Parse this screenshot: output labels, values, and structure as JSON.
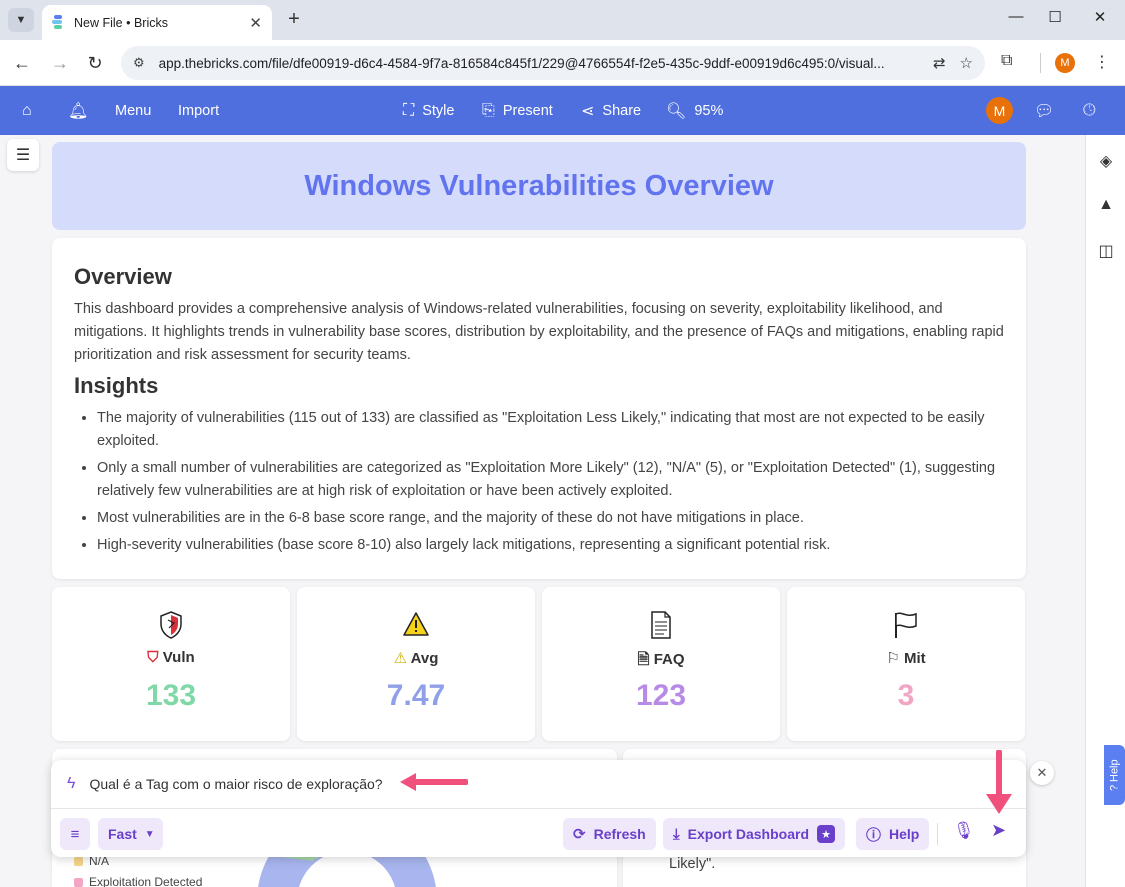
{
  "browser": {
    "tab_title": "New File • Bricks",
    "url": "app.thebricks.com/file/dfe00919-d6c4-4584-9f7a-816584c845f1/229@4766554f-f2e5-435c-9ddf-e00919d6c495:0/visual...",
    "profile_initial": "M"
  },
  "toolbar": {
    "menu_label": "Menu",
    "import_label": "Import",
    "style_label": "Style",
    "present_label": "Present",
    "share_label": "Share",
    "zoom_label": "95%",
    "avatar_initial": "M"
  },
  "dashboard": {
    "title": "Windows Vulnerabilities Overview",
    "overview_heading": "Overview",
    "overview_text": "This dashboard provides a comprehensive analysis of Windows-related vulnerabilities, focusing on severity, exploitability likelihood, and mitigations. It highlights trends in vulnerability base scores, distribution by exploitability, and the presence of FAQs and mitigations, enabling rapid prioritization and risk assessment for security teams.",
    "insights_heading": "Insights",
    "insights": [
      "The majority of vulnerabilities (115 out of 133) are classified as \"Exploitation Less Likely,\" indicating that most are not expected to be easily exploited.",
      "Only a small number of vulnerabilities are categorized as \"Exploitation More Likely\" (12), \"N/A\" (5), or \"Exploitation Detected\" (1), suggesting relatively few vulnerabilities are at high risk of exploitation or have been actively exploited.",
      "Most vulnerabilities are in the 6-8 base score range, and the majority of these do not have mitigations in place.",
      "High-severity vulnerabilities (base score 8-10) also largely lack mitigations, representing a significant potential risk."
    ],
    "kpis": [
      {
        "label": "Vuln",
        "value": "133",
        "icon": "shield-icon",
        "color": "#7fd8a6"
      },
      {
        "label": "Avg",
        "value": "7.47",
        "icon": "warning-icon",
        "color": "#8fa0e8"
      },
      {
        "label": "FAQ",
        "value": "123",
        "icon": "document-icon",
        "color": "#b68ae6"
      },
      {
        "label": "Mit",
        "value": "3",
        "icon": "flag-icon",
        "color": "#f2a6c4"
      }
    ],
    "legend": [
      {
        "label": "N/A",
        "color": "#f5d58a"
      },
      {
        "label": "Exploitation Detected",
        "color": "#f2a6c4"
      }
    ],
    "peek_text": "Likely\"."
  },
  "chat": {
    "prompt": "Qual é a Tag com o maior risco de exploração?",
    "mode_label": "Fast",
    "refresh_label": "Refresh",
    "export_label": "Export Dashboard",
    "help_label": "Help"
  },
  "side_help_label": "Help",
  "colors": {
    "toolbar_bg": "#4f6fdf",
    "title_bg": "#d5dcfb",
    "title_text": "#6273ef",
    "accent_purple": "#6a3fc9",
    "annotation_pink": "#f0507c"
  }
}
